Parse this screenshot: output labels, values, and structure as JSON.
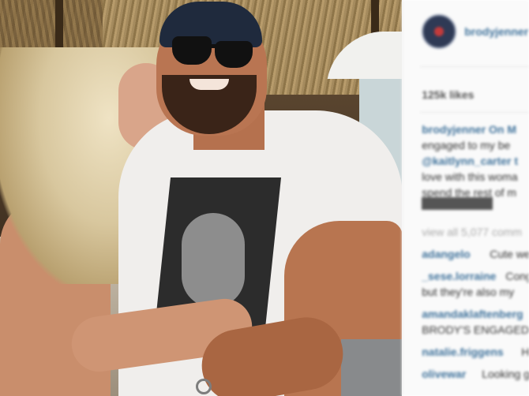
{
  "photo": {
    "description_icon": "photo-icon"
  },
  "panel": {
    "username": "brodyjenner",
    "likes": "125k likes",
    "caption_lines": [
      {
        "text": "brodyjenner On M",
        "style": "link"
      },
      {
        "text": "engaged to my be",
        "style": "normal"
      },
      {
        "text": "@kaitlynn_carter t",
        "style": "link"
      },
      {
        "text": "love with this woma",
        "style": "normal"
      },
      {
        "text": "spend the rest of m",
        "style": "normal"
      }
    ],
    "view_comments": "view all 5,077 comm",
    "comments": [
      {
        "user": "adangelo",
        "text": "Cute we"
      },
      {
        "user": "_sese.lorraine",
        "text": "Congrats"
      },
      {
        "user": "",
        "text": "but they're also my"
      },
      {
        "user": "amandaklaftenberg",
        "text": ""
      },
      {
        "user": "",
        "text": "BRODY'S ENGAGED"
      },
      {
        "user": "natalie.friggens",
        "text": "HE"
      },
      {
        "user": "olivewar",
        "text": "Looking g"
      }
    ],
    "colors": {
      "link": "#3f729b",
      "text": "#333333"
    }
  }
}
